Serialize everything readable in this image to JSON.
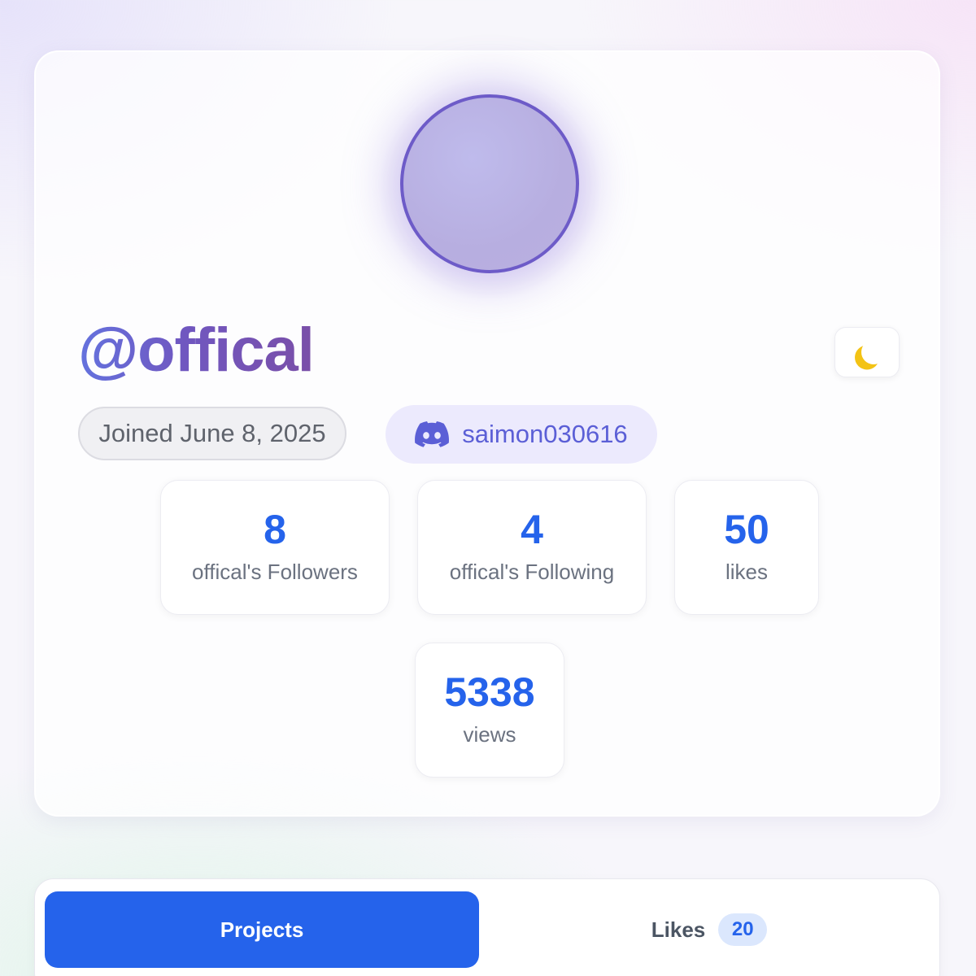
{
  "profile": {
    "username": "@offical",
    "joined": "Joined June 8, 2025",
    "discord": {
      "icon": "discord-icon",
      "handle": "saimon030616",
      "color": "#5b5fd6"
    },
    "theme_toggle_icon": "moon-icon"
  },
  "stats": {
    "followers": {
      "value": "8",
      "label": "offical's Followers"
    },
    "following": {
      "value": "4",
      "label": "offical's Following"
    },
    "likes": {
      "value": "50",
      "label": "likes"
    },
    "views": {
      "value": "5338",
      "label": "views"
    }
  },
  "tabs": {
    "projects": {
      "label": "Projects",
      "active": true
    },
    "likes": {
      "label": "Likes",
      "count": "20"
    }
  },
  "colors": {
    "accent": "#2563eb",
    "avatar_ring": "#6d5bc8"
  }
}
